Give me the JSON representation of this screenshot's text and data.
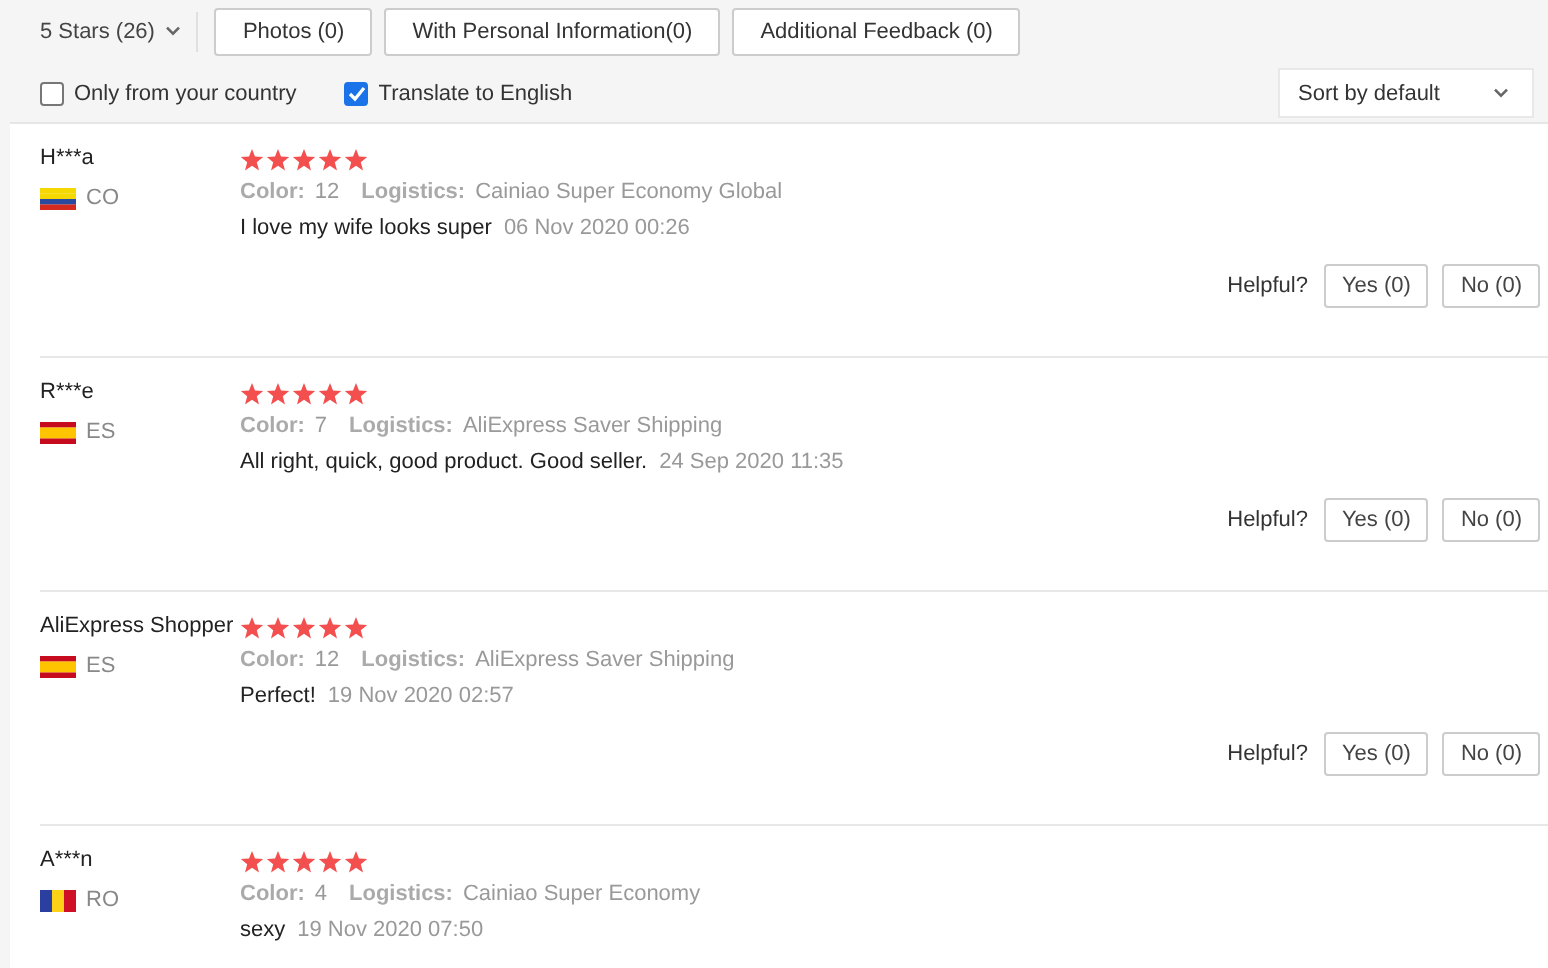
{
  "filters": {
    "star_filter": "5 Stars (26)",
    "buttons": [
      "Photos (0)",
      "With Personal Information(0)",
      "Additional Feedback (0)"
    ]
  },
  "options": [
    {
      "label": "Only from your country",
      "checked": false
    },
    {
      "label": "Translate to English",
      "checked": true
    }
  ],
  "sort": {
    "value": "Sort by default"
  },
  "reviews": [
    {
      "name": "H***a",
      "country": "CO",
      "kind": "colombia",
      "stars": 5,
      "color_label": "Color:",
      "color_value": "12",
      "logistics_label": "Logistics:",
      "logistics_value": "Cainiao Super Economy Global",
      "text": "I love my wife looks super",
      "date": "06 Nov 2020 00:26",
      "helpful": "Helpful?",
      "yes": "Yes (0)",
      "no": "No (0)"
    },
    {
      "name": "R***e",
      "country": "ES",
      "kind": "spain",
      "stars": 5,
      "color_label": "Color:",
      "color_value": "7",
      "logistics_label": "Logistics:",
      "logistics_value": "AliExpress Saver Shipping",
      "text": "All right, quick, good product. Good seller.",
      "date": "24 Sep 2020 11:35",
      "helpful": "Helpful?",
      "yes": "Yes (0)",
      "no": "No (0)"
    },
    {
      "name": "AliExpress Shopper",
      "country": "ES",
      "kind": "spain",
      "stars": 5,
      "color_label": "Color:",
      "color_value": "12",
      "logistics_label": "Logistics:",
      "logistics_value": "AliExpress Saver Shipping",
      "text": "Perfect!",
      "date": "19 Nov 2020 02:57",
      "helpful": "Helpful?",
      "yes": "Yes (0)",
      "no": "No (0)"
    },
    {
      "name": "A***n",
      "country": "RO",
      "kind": "romania",
      "stars": 5,
      "color_label": "Color:",
      "color_value": "4",
      "logistics_label": "Logistics:",
      "logistics_value": "Cainiao Super Economy",
      "text": "sexy",
      "date": "19 Nov 2020 07:50"
    }
  ]
}
